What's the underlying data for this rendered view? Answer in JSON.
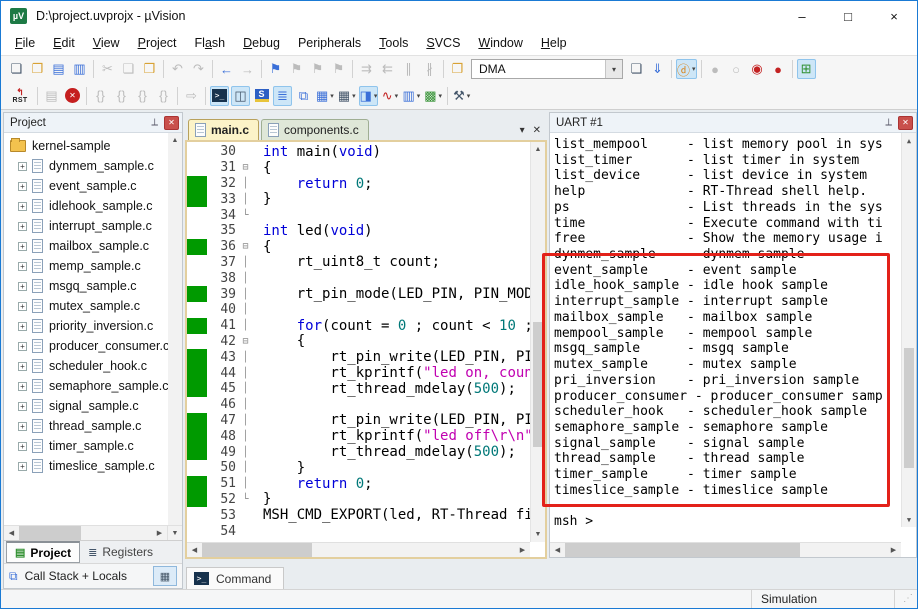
{
  "window": {
    "title": "D:\\project.uvprojx - µVision",
    "controls": {
      "minimize": "–",
      "maximize": "□",
      "close": "×"
    }
  },
  "menu": {
    "items": [
      {
        "label": "File",
        "u": 0
      },
      {
        "label": "Edit",
        "u": 0
      },
      {
        "label": "View",
        "u": 0
      },
      {
        "label": "Project",
        "u": 0
      },
      {
        "label": "Flash",
        "u": 2
      },
      {
        "label": "Debug",
        "u": 0
      },
      {
        "label": "Peripherals",
        "u": -1
      },
      {
        "label": "Tools",
        "u": 0
      },
      {
        "label": "SVCS",
        "u": 0
      },
      {
        "label": "Window",
        "u": 0
      },
      {
        "label": "Help",
        "u": 0
      }
    ]
  },
  "toolbar": {
    "dma_value": "DMA",
    "row1": [
      {
        "n": "new-file-button",
        "g": "❏",
        "c": "c-ink"
      },
      {
        "n": "open-file-button",
        "g": "❐",
        "c": "c-folder"
      },
      {
        "n": "save-button",
        "g": "▤",
        "c": "c-blue"
      },
      {
        "n": "save-all-button",
        "g": "▥",
        "c": "c-blue"
      },
      {
        "t": "sep"
      },
      {
        "n": "cut-button",
        "g": "✂",
        "c": "dis"
      },
      {
        "n": "copy-button",
        "g": "❑",
        "c": "dis"
      },
      {
        "n": "paste-button",
        "g": "❒",
        "c": "c-folder"
      },
      {
        "t": "sep"
      },
      {
        "n": "undo-button",
        "g": "↶",
        "c": "dis"
      },
      {
        "n": "redo-button",
        "g": "↷",
        "c": "dis"
      },
      {
        "t": "sep"
      },
      {
        "n": "navigate-back-button",
        "g": "←",
        "c": "c-blue"
      },
      {
        "n": "navigate-forward-button",
        "g": "→",
        "c": "dis"
      },
      {
        "t": "sep"
      },
      {
        "n": "bookmark-toggle-button",
        "g": "⚑",
        "c": "c-blue"
      },
      {
        "n": "bookmark-next-button",
        "g": "⚑",
        "c": "dis"
      },
      {
        "n": "bookmark-prev-button",
        "g": "⚑",
        "c": "dis"
      },
      {
        "n": "bookmark-clear-button",
        "g": "⚑",
        "c": "dis"
      },
      {
        "t": "sep"
      },
      {
        "n": "indent-right-button",
        "g": "⇉",
        "c": "dis"
      },
      {
        "n": "indent-left-button",
        "g": "⇇",
        "c": "dis"
      },
      {
        "n": "comment-button",
        "g": "∥",
        "c": "dis"
      },
      {
        "n": "uncomment-button",
        "g": "∦",
        "c": "dis"
      },
      {
        "t": "sep"
      },
      {
        "n": "find-in-files-button",
        "g": "❐",
        "c": "c-folder"
      },
      {
        "t": "combo",
        "n": "dma-combo"
      },
      {
        "n": "lookup-document-button",
        "g": "❏",
        "c": "c-ink"
      },
      {
        "n": "load-application-button",
        "g": "⇓",
        "c": "c-blue"
      },
      {
        "t": "sep"
      },
      {
        "n": "start-debug-session-button",
        "g": "ⓓ",
        "c": "c-orange act",
        "dd": true
      },
      {
        "t": "sep"
      },
      {
        "n": "breakpoint-insert-button",
        "g": "●",
        "c": "dis"
      },
      {
        "n": "breakpoint-enable-button",
        "g": "○",
        "c": "dis"
      },
      {
        "n": "breakpoint-disable-button",
        "g": "◉",
        "c": "c-red"
      },
      {
        "n": "breakpoint-kill-all-button",
        "g": "●",
        "c": "c-red"
      },
      {
        "t": "sep"
      },
      {
        "n": "window-layout-button",
        "g": "⊞",
        "c": "c-green act"
      }
    ],
    "row2": [
      {
        "t": "rst",
        "n": "reset-button",
        "label": "RST"
      },
      {
        "t": "sep"
      },
      {
        "n": "show-next-statement-button",
        "g": "▤",
        "c": "dis"
      },
      {
        "t": "stop",
        "n": "stop-debug-button"
      },
      {
        "t": "sep"
      },
      {
        "n": "step-into-button",
        "g": "{}",
        "c": "dis"
      },
      {
        "n": "step-over-button",
        "g": "{}",
        "c": "dis"
      },
      {
        "n": "step-out-button",
        "g": "{}",
        "c": "dis"
      },
      {
        "n": "run-to-cursor-button",
        "g": "{}",
        "c": "dis"
      },
      {
        "t": "sep"
      },
      {
        "n": "run-button",
        "g": "⇨",
        "c": "dis"
      },
      {
        "t": "sep"
      },
      {
        "t": "console",
        "n": "command-window-button"
      },
      {
        "n": "disassembly-window-button",
        "g": "◫",
        "c": "c-ink act"
      },
      {
        "t": "sym",
        "n": "symbol-window-button"
      },
      {
        "n": "registers-window-button",
        "g": "≣",
        "c": "c-blue act"
      },
      {
        "n": "call-stack-window-button",
        "g": "⧉",
        "c": "c-blue"
      },
      {
        "n": "watch-window-button",
        "g": "▦",
        "c": "c-blue",
        "dd": true
      },
      {
        "n": "memory-window-button",
        "g": "▦",
        "c": "c-ink",
        "dd": true
      },
      {
        "n": "serial-window-button",
        "g": "◨",
        "c": "c-blue act",
        "dd": true
      },
      {
        "n": "analysis-window-button",
        "g": "∿",
        "c": "c-red",
        "dd": true
      },
      {
        "n": "system-viewer-button",
        "g": "▥",
        "c": "c-blue",
        "dd": true
      },
      {
        "n": "toolbox-button",
        "g": "▩",
        "c": "c-green",
        "dd": true
      },
      {
        "t": "sep"
      },
      {
        "n": "configure-tools-button",
        "g": "⚒",
        "c": "c-ink",
        "dd": true
      }
    ]
  },
  "project_panel": {
    "title": "Project",
    "root": "kernel-sample",
    "files": [
      "dynmem_sample.c",
      "event_sample.c",
      "idlehook_sample.c",
      "interrupt_sample.c",
      "mailbox_sample.c",
      "memp_sample.c",
      "msgq_sample.c",
      "mutex_sample.c",
      "priority_inversion.c",
      "producer_consumer.c",
      "scheduler_hook.c",
      "semaphore_sample.c",
      "signal_sample.c",
      "thread_sample.c",
      "timer_sample.c",
      "timeslice_sample.c"
    ],
    "tabs": [
      "Project",
      "Registers"
    ],
    "call_stack_label": "Call Stack + Locals"
  },
  "editor": {
    "tabs": [
      {
        "label": "main.c"
      },
      {
        "label": "components.c"
      }
    ],
    "lines": [
      {
        "n": 30,
        "g": false,
        "f": "",
        "s": [
          [
            "k",
            "int"
          ],
          [
            "p",
            " main("
          ],
          [
            "k",
            "void"
          ],
          [
            "p",
            ")"
          ]
        ]
      },
      {
        "n": 31,
        "g": false,
        "f": "⊟",
        "s": [
          [
            "p",
            "{"
          ]
        ]
      },
      {
        "n": 32,
        "g": true,
        "f": "│",
        "s": [
          [
            "p",
            "    "
          ],
          [
            "k",
            "return"
          ],
          [
            "p",
            " "
          ],
          [
            "n",
            "0"
          ],
          [
            "p",
            ";"
          ]
        ]
      },
      {
        "n": 33,
        "g": true,
        "f": "│",
        "s": [
          [
            "p",
            "}"
          ]
        ]
      },
      {
        "n": 34,
        "g": false,
        "f": "└",
        "s": []
      },
      {
        "n": 35,
        "g": false,
        "f": "",
        "s": [
          [
            "k",
            "int"
          ],
          [
            "p",
            " led("
          ],
          [
            "k",
            "void"
          ],
          [
            "p",
            ")"
          ]
        ]
      },
      {
        "n": 36,
        "g": true,
        "f": "⊟",
        "s": [
          [
            "p",
            "{"
          ]
        ]
      },
      {
        "n": 37,
        "g": false,
        "f": "│",
        "s": [
          [
            "p",
            "    rt_uint8_t count;"
          ]
        ]
      },
      {
        "n": 38,
        "g": false,
        "f": "│",
        "s": []
      },
      {
        "n": 39,
        "g": true,
        "f": "│",
        "s": [
          [
            "p",
            "    rt_pin_mode(LED_PIN, PIN_MODE_"
          ]
        ]
      },
      {
        "n": 40,
        "g": false,
        "f": "│",
        "s": []
      },
      {
        "n": 41,
        "g": true,
        "f": "│",
        "s": [
          [
            "p",
            "    "
          ],
          [
            "k",
            "for"
          ],
          [
            "p",
            "(count = "
          ],
          [
            "n",
            "0"
          ],
          [
            "p",
            " ; count < "
          ],
          [
            "n",
            "10"
          ],
          [
            "p",
            " ;cc"
          ]
        ]
      },
      {
        "n": 42,
        "g": false,
        "f": "⊟",
        "s": [
          [
            "p",
            "    {"
          ]
        ]
      },
      {
        "n": 43,
        "g": true,
        "f": "│",
        "s": [
          [
            "p",
            "        rt_pin_write(LED_PIN, PIN_"
          ]
        ]
      },
      {
        "n": 44,
        "g": true,
        "f": "│",
        "s": [
          [
            "p",
            "        rt_kprintf("
          ],
          [
            "s",
            "\"led on, count"
          ]
        ]
      },
      {
        "n": 45,
        "g": true,
        "f": "│",
        "s": [
          [
            "p",
            "        rt_thread_mdelay("
          ],
          [
            "n",
            "500"
          ],
          [
            "p",
            ");"
          ]
        ]
      },
      {
        "n": 46,
        "g": false,
        "f": "│",
        "s": []
      },
      {
        "n": 47,
        "g": true,
        "f": "│",
        "s": [
          [
            "p",
            "        rt_pin_write(LED_PIN, PIN_"
          ]
        ]
      },
      {
        "n": 48,
        "g": true,
        "f": "│",
        "s": [
          [
            "p",
            "        rt_kprintf("
          ],
          [
            "s",
            "\"led off\\r\\n\""
          ],
          [
            "p",
            ");"
          ]
        ]
      },
      {
        "n": 49,
        "g": true,
        "f": "│",
        "s": [
          [
            "p",
            "        rt_thread_mdelay("
          ],
          [
            "n",
            "500"
          ],
          [
            "p",
            ");"
          ]
        ]
      },
      {
        "n": 50,
        "g": false,
        "f": "│",
        "s": [
          [
            "p",
            "    }"
          ]
        ]
      },
      {
        "n": 51,
        "g": true,
        "f": "│",
        "s": [
          [
            "p",
            "    "
          ],
          [
            "k",
            "return"
          ],
          [
            "p",
            " "
          ],
          [
            "n",
            "0"
          ],
          [
            "p",
            ";"
          ]
        ]
      },
      {
        "n": 52,
        "g": true,
        "f": "└",
        "s": [
          [
            "p",
            "}"
          ]
        ]
      },
      {
        "n": 53,
        "g": false,
        "f": "",
        "s": [
          [
            "p",
            "MSH_CMD_EXPORT(led, RT-Thread firs"
          ]
        ]
      },
      {
        "n": 54,
        "g": false,
        "f": "",
        "s": []
      }
    ]
  },
  "uart": {
    "title": "UART #1",
    "lines": [
      "list_mempool     - list memory pool in sys",
      "list_timer       - list timer in system",
      "list_device      - list device in system",
      "help             - RT-Thread shell help.",
      "ps               - List threads in the sys",
      "time             - Execute command with ti",
      "free             - Show the memory usage i",
      "dynmem_sample    - dynmem sample",
      "event_sample     - event sample",
      "idle_hook_sample - idle hook sample",
      "interrupt_sample - interrupt sample",
      "mailbox_sample   - mailbox sample",
      "mempool_sample   - mempool sample",
      "msgq_sample      - msgq sample",
      "mutex_sample     - mutex sample",
      "pri_inversion    - pri_inversion sample",
      "producer_consumer - producer_consumer samp",
      "scheduler_hook   - scheduler_hook sample",
      "semaphore_sample - semaphore sample",
      "signal_sample    - signal sample",
      "thread_sample    - thread sample",
      "timer_sample     - timer sample",
      "timeslice_sample - timeslice sample",
      "",
      "msh >"
    ]
  },
  "annotation": {
    "type": "red-box",
    "color": "#e32119",
    "region": "uart-sample-commands"
  },
  "command_tab": {
    "label": "Command"
  },
  "status": {
    "simulation": "Simulation"
  }
}
